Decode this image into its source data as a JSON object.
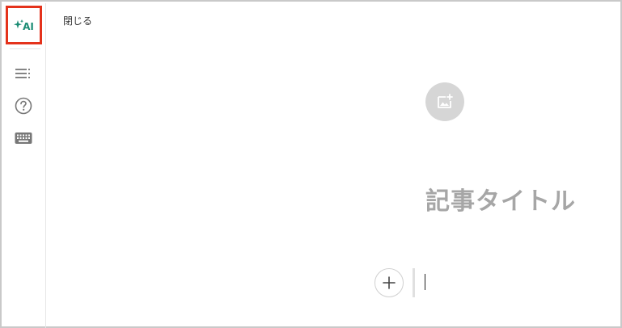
{
  "sidebar": {
    "ai_button_label": "AI",
    "items": [
      {
        "icon": "table-of-contents-icon"
      },
      {
        "icon": "help-icon"
      },
      {
        "icon": "keyboard-icon"
      }
    ]
  },
  "header": {
    "close_label": "閉じる"
  },
  "editor": {
    "title_placeholder": "記事タイトル"
  },
  "colors": {
    "ai_accent": "#1b8c74",
    "highlight_border": "#e4321b",
    "placeholder": "#a6a6a6"
  }
}
